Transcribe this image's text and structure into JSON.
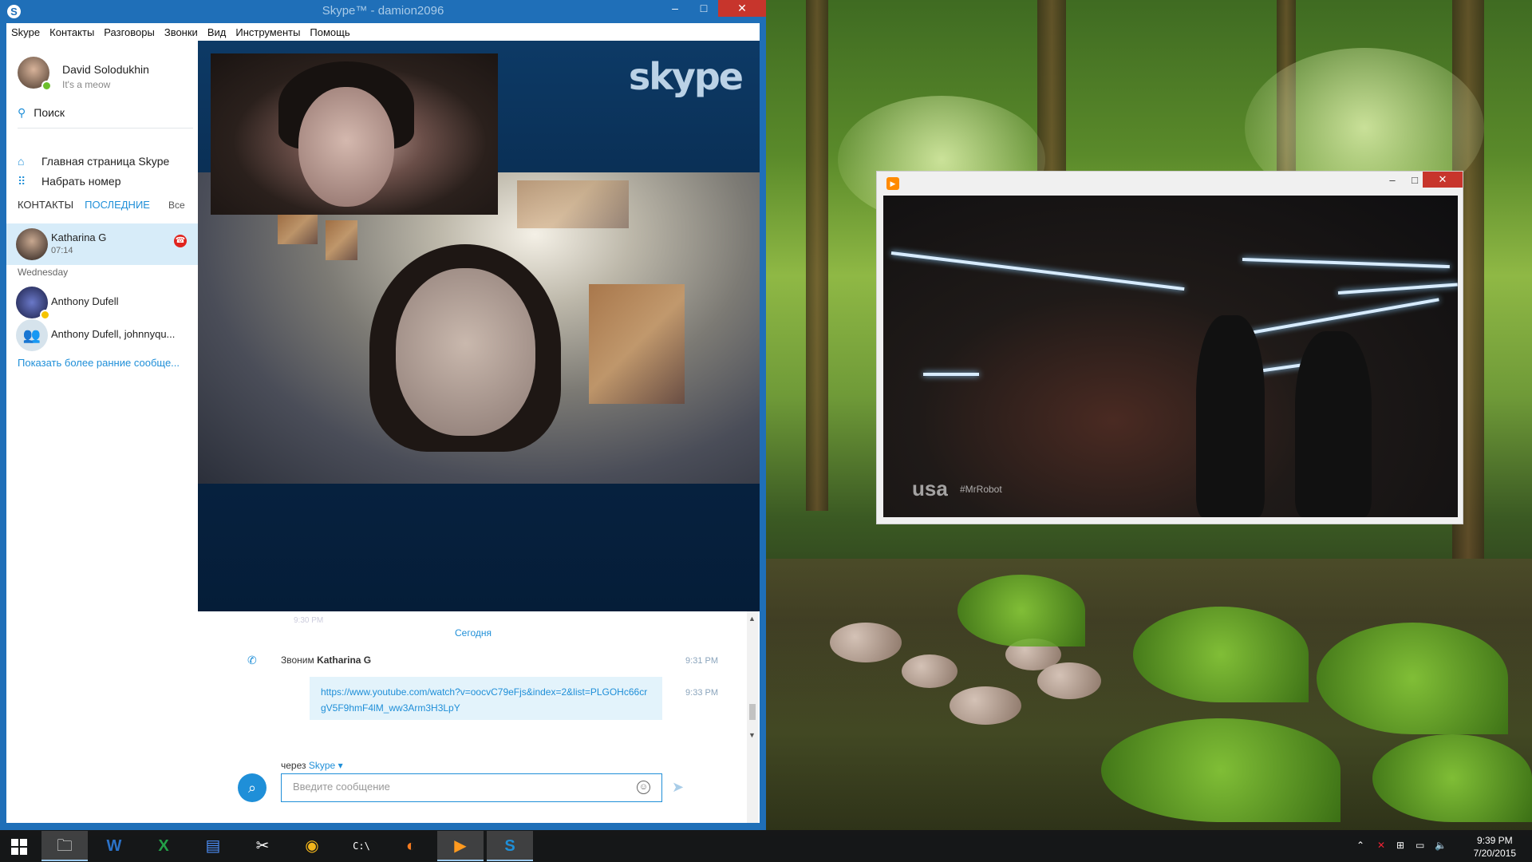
{
  "skype_window": {
    "title": "Skype™ - damion2096",
    "app_icon": "S",
    "controls": {
      "minimize": "–",
      "maximize": "□",
      "close": "✕"
    },
    "menu": [
      "Skype",
      "Контакты",
      "Разговоры",
      "Звонки",
      "Вид",
      "Инструменты",
      "Помощь"
    ]
  },
  "profile": {
    "name": "David Solodukhin",
    "mood": "It's a meow",
    "status_color": "#6cbf2c"
  },
  "sidebar": {
    "search_label": "Поиск",
    "home_label": "Главная страница Skype",
    "dial_label": "Набрать номер",
    "tab_contacts": "КОНТАКТЫ",
    "tab_recent": "ПОСЛЕДНИЕ",
    "filter": "Все",
    "active_contact": {
      "name": "Katharina G",
      "sub": "07:14"
    },
    "day_label": "Wednesday",
    "contacts": [
      {
        "name": "Anthony Dufell"
      },
      {
        "name": "Anthony Dufell, johnnyqu..."
      }
    ],
    "show_earlier": "Показать более ранние сообще..."
  },
  "call": {
    "brand_logo": "skype"
  },
  "chat": {
    "faded_time": "9:30 PM",
    "today_label": "Сегодня",
    "call_prefix": "Звоним",
    "call_name": "Katharina G",
    "call_time": "9:31 PM",
    "message_text": "https://www.youtube.com/watch?v=oocvC79eFjs&index=2&list=PLGOHc66crgV5F9hmF4lM_ww3Arm3H3LpY",
    "message_time": "9:33 PM",
    "via_prefix": "через",
    "via_service": "Skype",
    "input_placeholder": "Введите сообщение"
  },
  "player": {
    "controls": {
      "minimize": "–",
      "maximize": "□",
      "close": "✕"
    },
    "watermark": "usa",
    "hashtag": "#MrRobot"
  },
  "taskbar": {
    "apps": [
      {
        "name": "file-explorer",
        "glyph": "🗀"
      },
      {
        "name": "word",
        "glyph": "W"
      },
      {
        "name": "excel",
        "glyph": "X"
      },
      {
        "name": "docs",
        "glyph": "▤"
      },
      {
        "name": "snipping-tool",
        "glyph": "✂"
      },
      {
        "name": "chrome",
        "glyph": "◉"
      },
      {
        "name": "command-prompt",
        "glyph": "C:\\"
      },
      {
        "name": "firefox",
        "glyph": "◐"
      },
      {
        "name": "media-player",
        "glyph": "▶"
      },
      {
        "name": "skype",
        "glyph": "S"
      }
    ],
    "tray": {
      "time": "9:39 PM",
      "date": "7/20/2015"
    }
  },
  "colors": {
    "skype_blue": "#1f6fb8",
    "link_blue": "#1f8fd8",
    "hangup_red": "#e0241f",
    "selected_row": "#d7ecf9"
  }
}
